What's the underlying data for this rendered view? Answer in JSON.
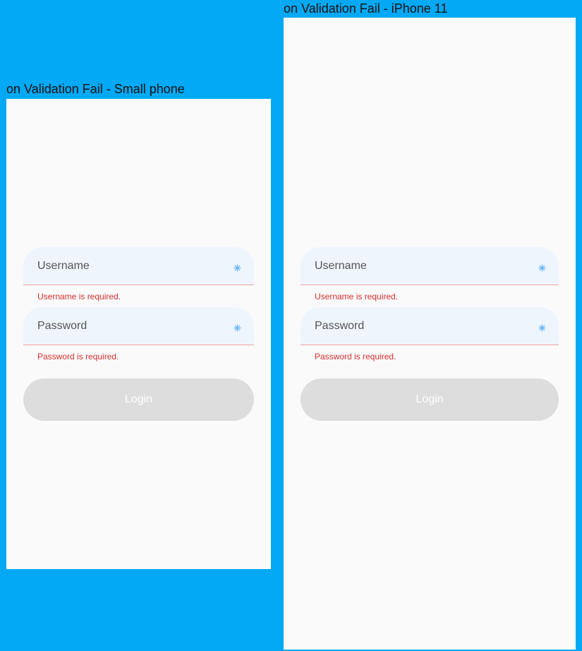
{
  "panels": [
    {
      "title": "on Validation Fail - Small phone",
      "form": {
        "username_label": "Username",
        "username_error": "Username is required.",
        "password_label": "Password",
        "password_error": "Password is required.",
        "login_label": "Login",
        "field_icon": "sparkle-icon"
      }
    },
    {
      "title": "on Validation Fail - iPhone 11",
      "form": {
        "username_label": "Username",
        "username_error": "Username is required.",
        "password_label": "Password",
        "password_error": "Password is required.",
        "login_label": "Login",
        "field_icon": "sparkle-icon"
      }
    }
  ],
  "colors": {
    "canvas": "#03A9F4",
    "screen": "#FAFAFA",
    "field_fill": "#EFF5FD",
    "field_error_underline": "#F2A0A4",
    "error_text": "#D32F2F",
    "button_disabled": "#DDDDDD",
    "button_text": "#FFFFFF",
    "icon": "#64B5F6"
  }
}
